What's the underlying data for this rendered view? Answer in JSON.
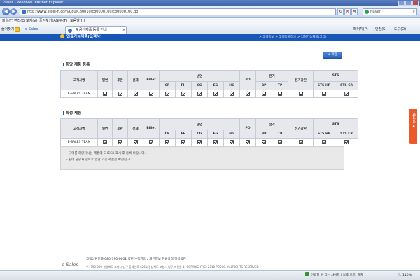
{
  "browser": {
    "window_title": "-Sales - Windows Internet Explorer",
    "url": "http://www.steel-n.com/C80/C80010/c80000100/c80000100.do",
    "search_placeholder": "Naver",
    "menu": [
      "파일(F)",
      "편집(E)",
      "보기(V)",
      "즐겨찾기(A)",
      "도구(T)",
      "도움말(H)"
    ],
    "favorites_label": "즐겨찾기",
    "favorites_site": "e-Sales",
    "tab_title": "4 공산재품 등록 안내",
    "tools": [
      "페이지(P)",
      "안전(S)",
      "도구(O)"
    ],
    "status": {
      "left": "",
      "zone": "신뢰할 수 있는 사이트 | 보호 모드: 해제",
      "zoom": "110%"
    }
  },
  "page": {
    "title": "입찰가능제품(고객사)",
    "breadcrumb": "> 고객정보 > 고객등록정보 > 입찰가능제품(고객)",
    "register_button": "+ 저장",
    "quick_label": "Quick ◀",
    "notes": [
      "- 구매를 희망하시는 제품에 CHECK 표시 후 등록 바랍니다.",
      "- 판매 담당자 검토후 입찰 가능 제품은 확정됩니다."
    ]
  },
  "table_headers": {
    "customer": "고객사명",
    "hot_rolled": "열연",
    "plate": "후판",
    "wire": "선재",
    "billet": "Billet",
    "cold": "냉연",
    "cold_sub": [
      "CR",
      "FH",
      "CG",
      "EG",
      "HG"
    ],
    "po": "PO",
    "electrical": "전기",
    "electrical_sub": [
      "BP",
      "TP"
    ],
    "electrical_steel": "전기강판",
    "sts": "STS",
    "sts_sub": [
      "STS HR",
      "STS CR"
    ]
  },
  "sections": [
    {
      "title": "희망 제품 등록",
      "rows": [
        {
          "customer": "E-SALES TEAM",
          "checked": [
            true,
            true,
            true,
            true,
            true,
            true,
            true,
            true,
            true,
            true,
            true,
            true,
            true,
            true,
            true
          ]
        }
      ]
    },
    {
      "title": "확정 제품",
      "rows": [
        {
          "customer": "E-SALES TEAM",
          "checked": [
            true,
            true,
            true,
            true,
            true,
            true,
            true,
            true,
            true,
            true,
            true,
            true,
            true,
            true,
            true
          ]
        }
      ]
    }
  ],
  "footer": {
    "logo": "e-Sales",
    "links": "고객상담전화 080-790-0001    약관/수정가입 /    개인정보 취급방침/이용약관",
    "address": "우. 790-300 경상북도 포항시 남구 동해안로 6261(경상북도 포항시 남구 괴동동 1)      COPYRIGHT(C) 2010 POSCO. ALLRIGHTS RESERVED"
  }
}
